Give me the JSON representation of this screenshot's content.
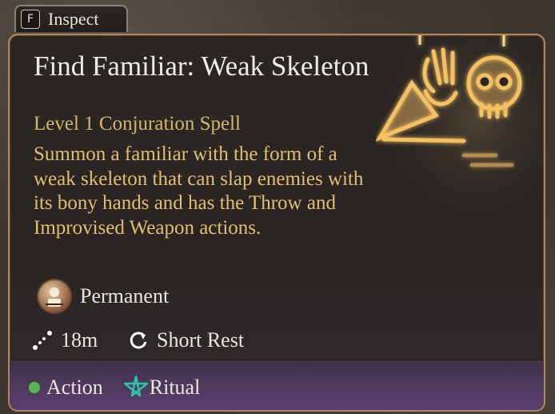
{
  "inspect": {
    "key": "F",
    "label": "Inspect"
  },
  "spell": {
    "title": "Find Familiar: Weak Skeleton",
    "subtitle": "Level 1 Conjuration Spell",
    "description": "Summon a familiar with the form of a weak skeleton that can slap enemies with its bony hands and has the Throw and Improvised Weapon actions.",
    "duration": "Permanent",
    "range": "18m",
    "recharge": "Short Rest"
  },
  "footer": {
    "action_label": "Action",
    "ritual_label": "Ritual"
  },
  "colors": {
    "title": "#f2ede4",
    "subtitle": "#d4b66d",
    "description": "#e3bf6f",
    "border": "#b6845a",
    "footer_purple": "#5c3f73",
    "action_green": "#5fb05a",
    "ritual_teal": "#2ec4a6"
  },
  "icons": {
    "duration": "skeleton-portrait-icon",
    "range": "range-dots-icon",
    "recharge": "rest-cycle-icon",
    "action": "action-dot-icon",
    "ritual": "ritual-star-icon",
    "art": "skeleton-hand-skull-art"
  }
}
